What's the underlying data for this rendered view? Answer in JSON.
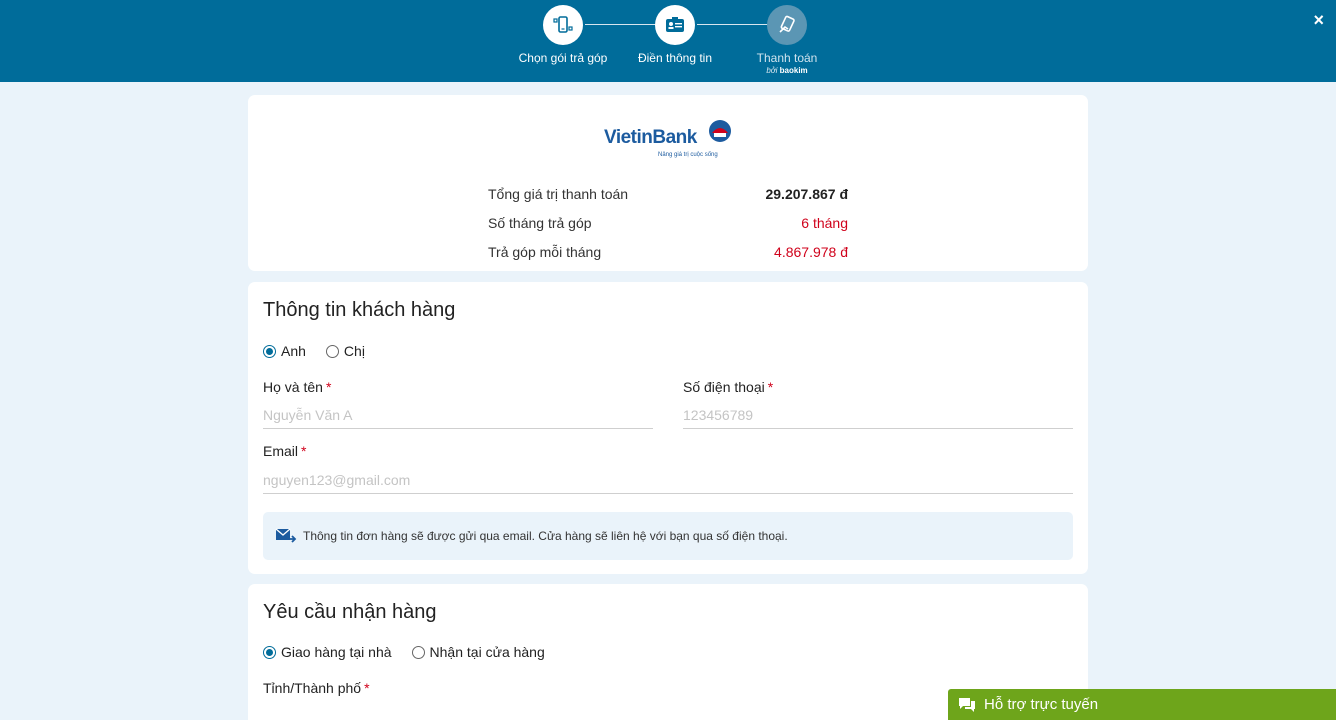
{
  "stepper": {
    "steps": [
      {
        "label": "Chọn gói trả góp",
        "icon": "phone-install-icon",
        "state": "done"
      },
      {
        "label": "Điền thông tin",
        "icon": "id-card-icon",
        "state": "active"
      },
      {
        "label": "Thanh toán",
        "icon": "card-payment-icon",
        "state": "pending",
        "sub_prefix": "bởi",
        "sub_brand": "baokim"
      }
    ]
  },
  "close_icon": "×",
  "summary": {
    "bank_name": "VietinBank",
    "bank_tagline": "Nâng giá trị cuộc sống",
    "rows": [
      {
        "label": "Tổng giá trị thanh toán",
        "value": "29.207.867 đ"
      },
      {
        "label": "Số tháng trả góp",
        "value": "6 tháng"
      },
      {
        "label": "Trả góp mỗi tháng",
        "value": "4.867.978 đ"
      }
    ]
  },
  "customer": {
    "title": "Thông tin khách hàng",
    "gender_options": [
      {
        "label": "Anh",
        "checked": true
      },
      {
        "label": "Chị",
        "checked": false
      }
    ],
    "name_label": "Họ và tên",
    "name_placeholder": "Nguyễn Văn A",
    "phone_label": "Số điện thoại",
    "phone_placeholder": "123456789",
    "email_label": "Email",
    "email_placeholder": "nguyen123@gmail.com",
    "required_mark": "*",
    "notice": "Thông tin đơn hàng sẽ được gửi qua email. Cửa hàng sẽ liên hệ với bạn qua số điện thoại."
  },
  "delivery": {
    "title": "Yêu cầu nhận hàng",
    "options": [
      {
        "label": "Giao hàng tại nhà",
        "checked": true
      },
      {
        "label": "Nhận tại cửa hàng",
        "checked": false
      }
    ],
    "city_label": "Tỉnh/Thành phố",
    "required_mark": "*"
  },
  "support": {
    "label": "Hỗ trợ trực tuyến"
  },
  "colors": {
    "header": "#006c9a",
    "accent_red": "#d0021b",
    "support_green": "#6ea51b",
    "page_bg": "#eaf3fa"
  }
}
